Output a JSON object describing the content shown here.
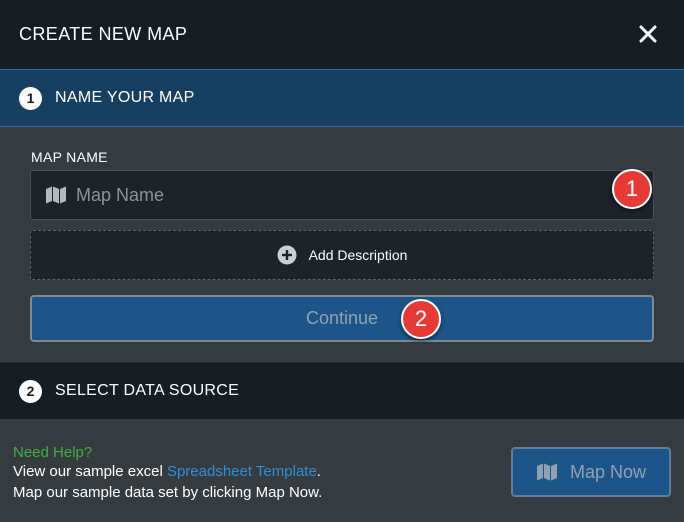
{
  "header": {
    "title": "CREATE NEW MAP",
    "close_icon": "close-icon"
  },
  "steps": [
    {
      "number": "1",
      "label": "NAME YOUR MAP",
      "state": "active"
    },
    {
      "number": "2",
      "label": "SELECT DATA SOURCE",
      "state": "inactive"
    }
  ],
  "form": {
    "map_name_label": "MAP NAME",
    "map_name_placeholder": "Map Name",
    "map_name_value": "",
    "map_name_icon": "map-icon",
    "add_description_label": "Add Description",
    "add_description_icon": "plus-circle-icon",
    "continue_label": "Continue"
  },
  "annotations": [
    {
      "number": "1",
      "target": "map-name-input"
    },
    {
      "number": "2",
      "target": "continue-button"
    }
  ],
  "footer": {
    "help_title": "Need Help?",
    "line1_prefix": "View our sample excel ",
    "line1_link": "Spreadsheet Template",
    "line1_suffix": ".",
    "line2": "Map our sample data set by clicking Map Now.",
    "map_now_label": "Map Now",
    "map_now_icon": "map-icon"
  },
  "colors": {
    "header_bg": "#161d23",
    "active_step_bg": "#173f62",
    "primary_button": "#1d5588",
    "help_green": "#3fae49",
    "link_blue": "#2b8ed8",
    "annotation_red": "#e63a36"
  }
}
